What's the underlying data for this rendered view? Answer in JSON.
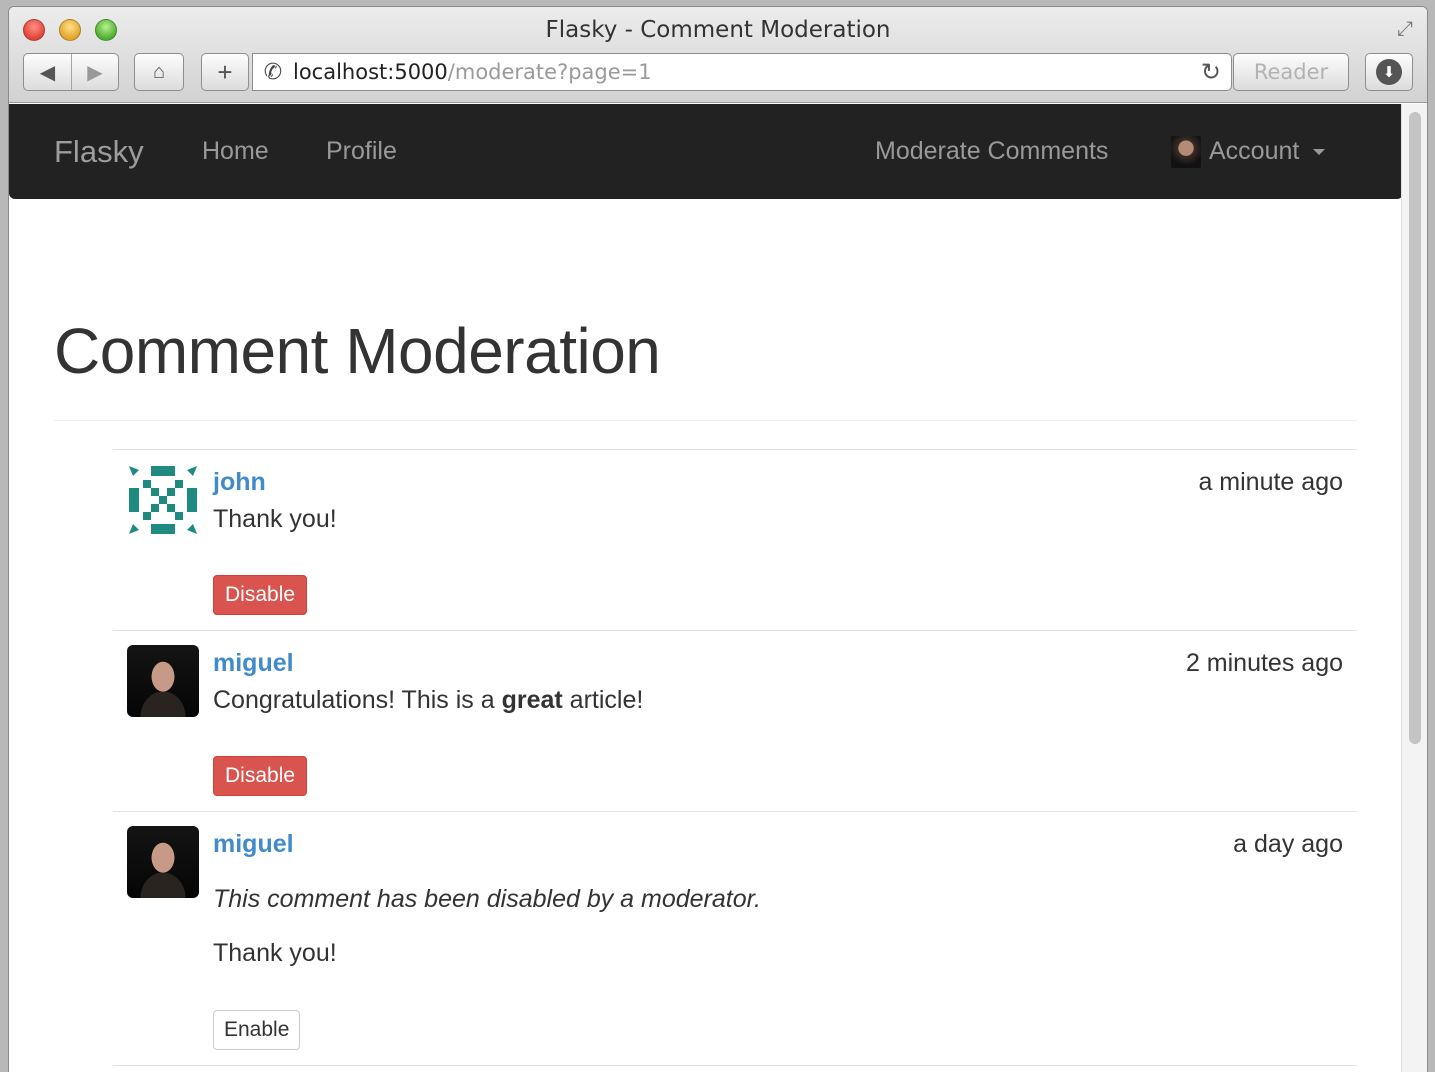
{
  "window": {
    "title": "Flasky - Comment Moderation",
    "url_host": "localhost:5000",
    "url_path": "/moderate?page=1",
    "reader_label": "Reader"
  },
  "navbar": {
    "brand": "Flasky",
    "home": "Home",
    "profile": "Profile",
    "moderate": "Moderate Comments",
    "account": "Account"
  },
  "page": {
    "title": "Comment Moderation"
  },
  "comments": [
    {
      "author": "john",
      "timestamp": "a minute ago",
      "body": "Thank you!",
      "action": "Disable"
    },
    {
      "author": "miguel",
      "timestamp": "2 minutes ago",
      "body_before": "Congratulations! This is a ",
      "body_bold": "great",
      "body_after": " article!",
      "action": "Disable"
    },
    {
      "author": "miguel",
      "timestamp": "a day ago",
      "disabled_note": "This comment has been disabled by a moderator.",
      "body": "Thank you!",
      "action": "Enable"
    }
  ],
  "colors": {
    "navbar_bg": "#222222",
    "link": "#428bca",
    "danger": "#d9534f"
  },
  "icons": {
    "back": "back-arrow-icon",
    "forward": "forward-arrow-icon",
    "home": "home-icon",
    "add": "plus-icon",
    "site": "phone-icon",
    "reload": "reload-icon",
    "download": "download-icon"
  }
}
